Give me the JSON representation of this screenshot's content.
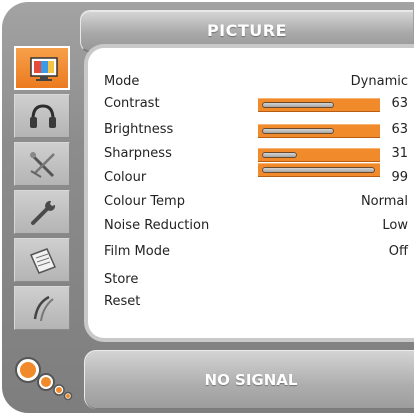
{
  "header": {
    "title": "PICTURE"
  },
  "sidebar": {
    "icons": [
      {
        "name": "picture-icon",
        "active": true
      },
      {
        "name": "headphones-icon",
        "active": false
      },
      {
        "name": "tools-icon",
        "active": false
      },
      {
        "name": "wrench-icon",
        "active": false
      },
      {
        "name": "document-icon",
        "active": false
      },
      {
        "name": "feather-icon",
        "active": false
      }
    ]
  },
  "menu": {
    "mode": {
      "label": "Mode",
      "value": "Dynamic"
    },
    "contrast": {
      "label": "Contrast",
      "value": "63",
      "level": 0.63
    },
    "brightness": {
      "label": "Brightness",
      "value": "63",
      "level": 0.63
    },
    "sharpness": {
      "label": "Sharpness",
      "value": "31",
      "level": 0.31
    },
    "colour": {
      "label": "Colour",
      "value": "99",
      "level": 0.99
    },
    "colour_temp": {
      "label": "Colour Temp",
      "value": "Normal"
    },
    "noise_reduction": {
      "label": "Noise Reduction",
      "value": "Low"
    },
    "film_mode": {
      "label": "Film Mode",
      "value": "Off"
    },
    "store": {
      "label": "Store"
    },
    "reset": {
      "label": "Reset"
    }
  },
  "status": {
    "text": "NO SIGNAL"
  },
  "colors": {
    "accent": "#f08a2a",
    "frame": "#8c8c8c",
    "panel": "#ffffff"
  }
}
